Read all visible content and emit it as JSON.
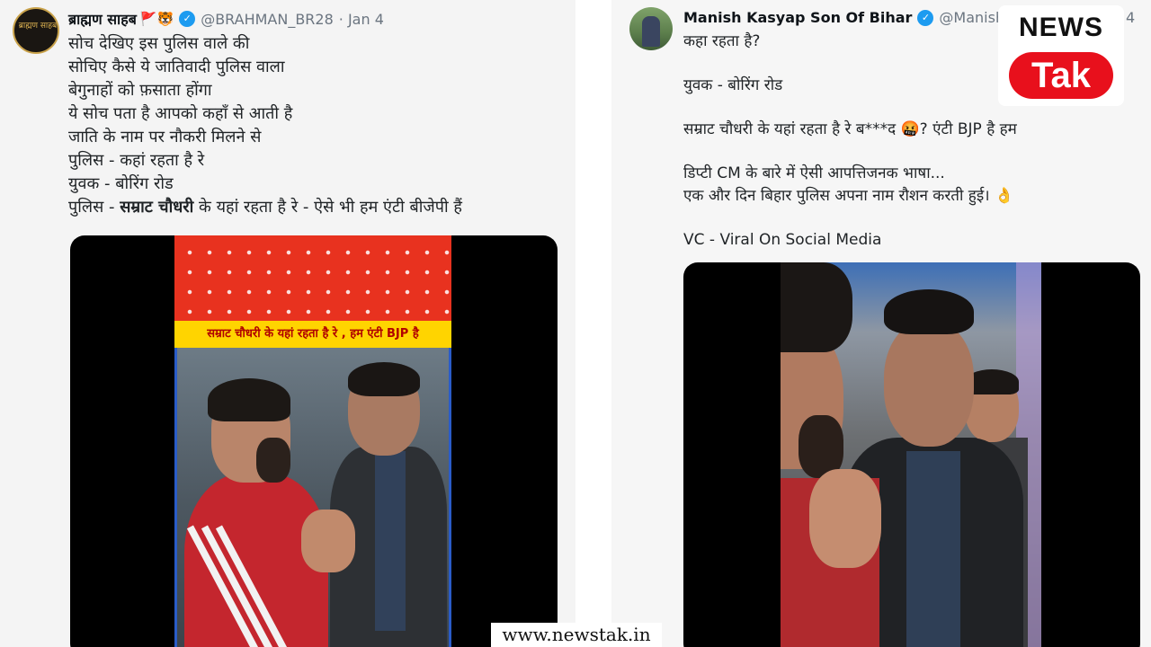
{
  "left_tweet": {
    "name": "ब्राह्मण साहब",
    "name_emojis": "🚩🐯",
    "handle": "@BRAHMAN_BR28",
    "date": "· Jan 4",
    "avatar_text": "ब्राह्मण साहब",
    "lines": [
      "सोच देखिए इस पुलिस वाले की",
      "सोचिए कैसे ये जातिवादी पुलिस वाला",
      "बेगुनाहों को फ़साता होंगा",
      "ये सोच पता है आपको कहाँ से आती है",
      "जाति के नाम पर नौकरी मिलने से",
      "पुलिस - कहां रहता है रे",
      "युवक - बोरिंग रोड"
    ],
    "last_line": {
      "prefix": "पुलिस - ",
      "bold": "सम्राट चौधरी",
      "suffix": " के यहां रहता है रे - ऐसे भी हम एंटी बीजेपी हैं"
    },
    "video_banner": "सम्राट चौधरी के यहां रहता है रे , हम एंटी BJP है"
  },
  "right_tweet": {
    "name": "Manish Kasyap Son Of Bihar",
    "handle": "@Manish",
    "date_fragment": "4",
    "lines": [
      "कहा रहता है?",
      "",
      "युवक - बोरिंग रोड",
      "",
      " सम्राट चौधरी के यहां रहता है रे ब***द 🤬? एंटी BJP है हम",
      "",
      "डिप्टी CM के बारे में ऐसी आपत्तिजनक भाषा...",
      "एक और दिन बिहार पुलिस अपना नाम रौशन करती हुई। 👌",
      "",
      "VC - Viral On Social Media"
    ]
  },
  "logo": {
    "top": "NEWS",
    "bottom": "Tak"
  },
  "watermark": "www.newstak.in",
  "colors": {
    "verified": "#1d9bf0",
    "logo_red": "#e8101c",
    "banner_yellow": "#ffd400",
    "video_red": "#e8321f"
  }
}
